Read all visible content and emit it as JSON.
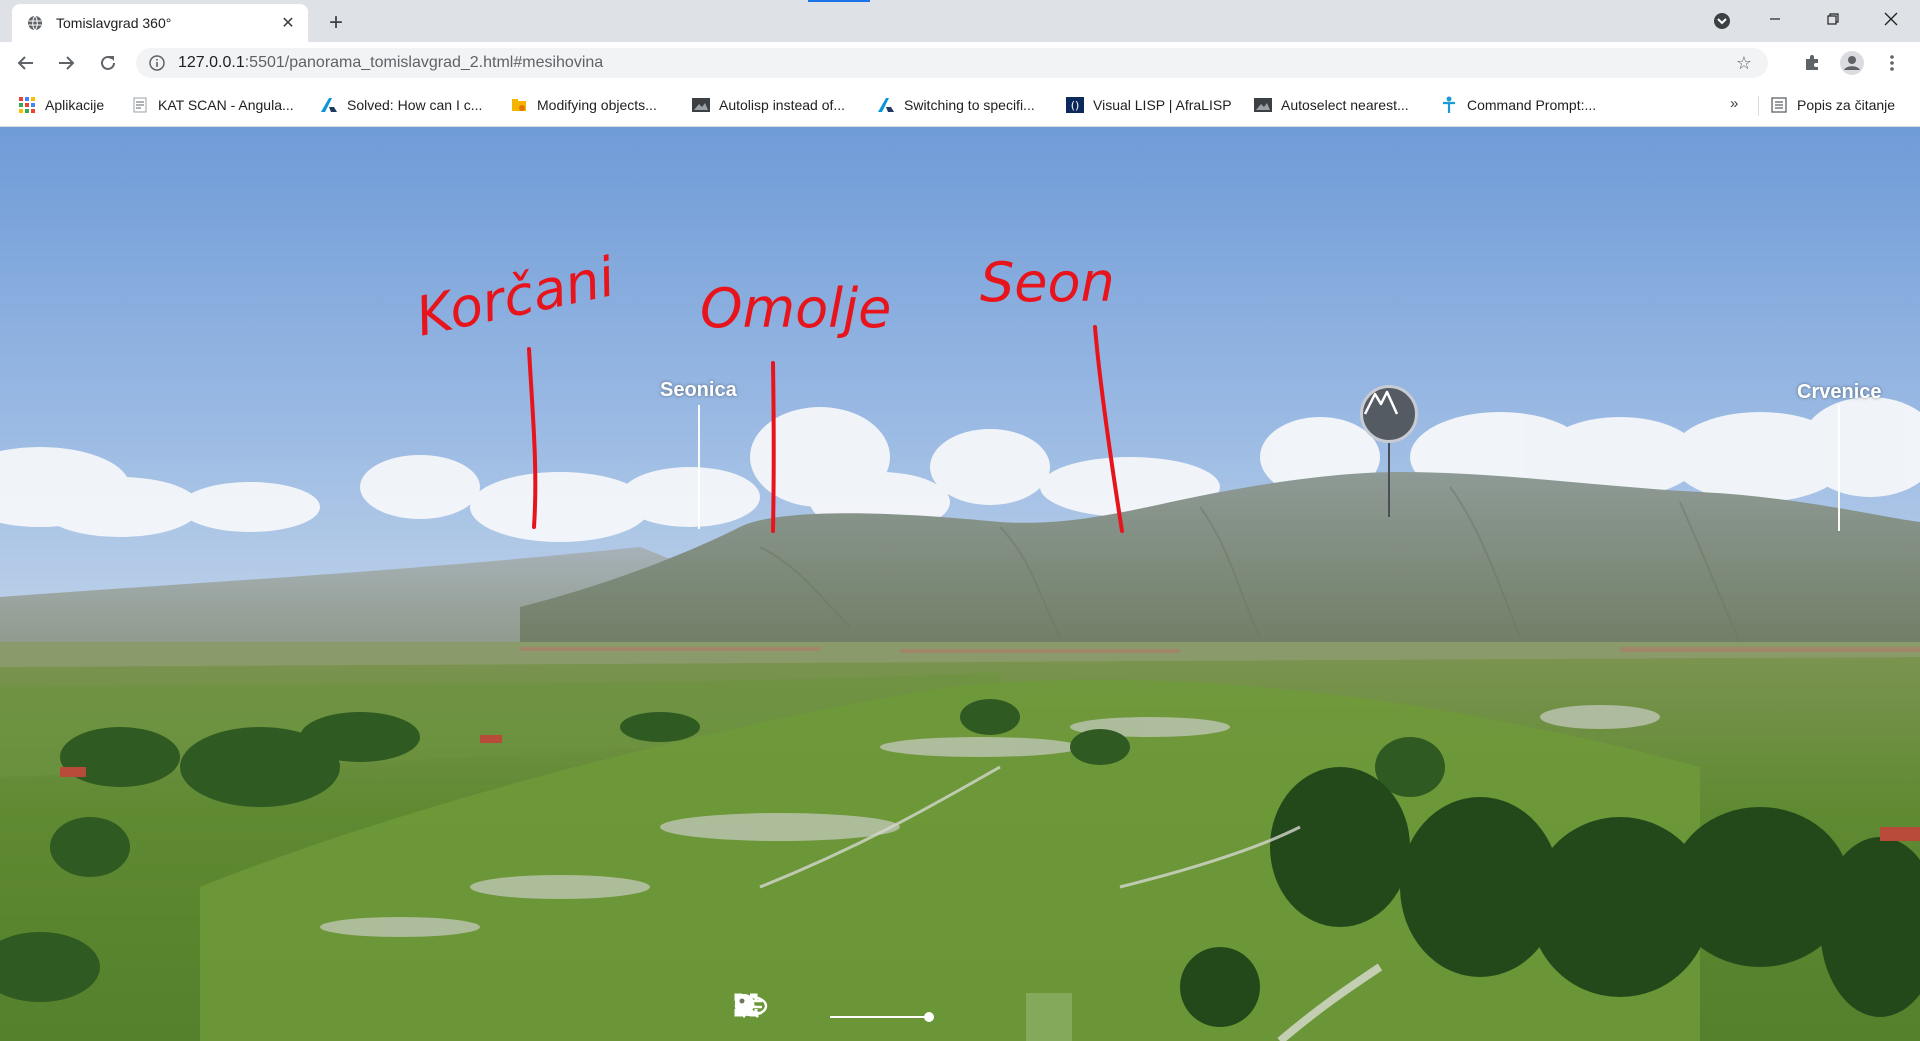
{
  "browser": {
    "tab_title": "Tomislavgrad 360°",
    "url_host": "127.0.0.1",
    "url_rest": ":5501/panorama_tomislavgrad_2.html#mesihovina"
  },
  "bookmarks": [
    {
      "label": "Aplikacije",
      "icon": "apps-grid-icon"
    },
    {
      "label": "KAT SCAN - Angula...",
      "icon": "document-icon"
    },
    {
      "label": "Solved: How can I c...",
      "icon": "autodesk-icon"
    },
    {
      "label": "Modifying objects...",
      "icon": "folder-lock-icon"
    },
    {
      "label": "Autolisp instead of...",
      "icon": "image-icon"
    },
    {
      "label": "Switching to specifi...",
      "icon": "autodesk-icon"
    },
    {
      "label": "Visual LISP | AfraLISP",
      "icon": "lisp-icon"
    },
    {
      "label": "Autoselect nearest...",
      "icon": "image-icon"
    },
    {
      "label": "Command Prompt:...",
      "icon": "figure-icon"
    }
  ],
  "bookmarks_more": "»",
  "reading_list": "Popis za čitanje",
  "panorama": {
    "poi_labels": [
      "Seonica",
      "Crvenice"
    ],
    "annotations": [
      "Korčani",
      "Omolje",
      "Seon"
    ]
  },
  "colors": {
    "sky_top": "#6f9bd7",
    "sky_bottom": "#b7cfe9",
    "mountain": "#7f8c80",
    "field": "#6a8c3c",
    "annotation_red": "#e8141c",
    "chrome_bg": "#dee1e6"
  }
}
